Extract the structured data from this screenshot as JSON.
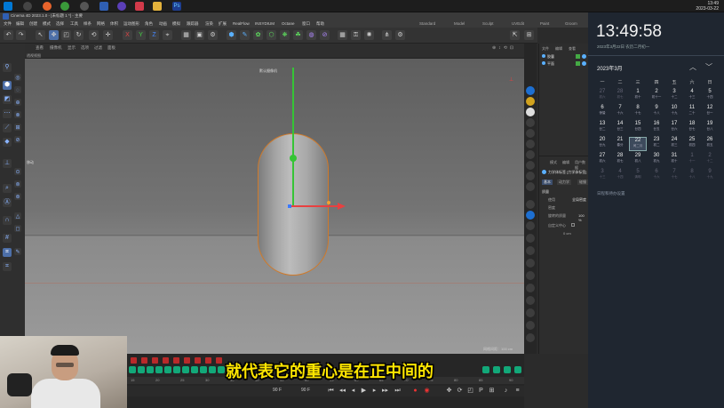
{
  "taskbar": {
    "time": "13:49",
    "date": "2023-03-22"
  },
  "window": {
    "title": "Cinema 4D 2023.1.0 - [未标题 1 *] - 主要",
    "tab_label": "未标题 1 *"
  },
  "menu": {
    "items": [
      "文件",
      "编辑",
      "创建",
      "模式",
      "选择",
      "工具",
      "样条",
      "网格",
      "体积",
      "运动图形",
      "角色",
      "动画",
      "模拟",
      "跟踪器",
      "渲染",
      "扩展",
      "RealFlow",
      "INSYDIUM",
      "Octane",
      "窗口",
      "帮助"
    ],
    "layouts": [
      "Standard",
      "Model",
      "Sculpt",
      "UVEdit",
      "Paint",
      "Groom"
    ]
  },
  "viewport": {
    "menu": [
      "查看",
      "摄像机",
      "显示",
      "选项",
      "过滤",
      "面板"
    ],
    "label": "透视视图",
    "camera": "默认摄像机",
    "move_label": "移动",
    "grid_spacing": "网格间距：100 cm"
  },
  "object_manager": {
    "tabs": [
      "文件",
      "编辑",
      "查看"
    ],
    "objects": [
      "胶囊",
      "平面"
    ]
  },
  "attribute_manager": {
    "tabs": [
      "模式",
      "编辑",
      "用户数据"
    ],
    "object_label": "力学体标签 [力学体标签]",
    "subtabs": [
      "基本",
      "动力学",
      "碰撞"
    ],
    "section": "质量",
    "rows": [
      {
        "label": "使用",
        "value": "全局密度"
      },
      {
        "label": "密度",
        "value": ""
      },
      {
        "label": "旋转的质量",
        "value": "100 %"
      },
      {
        "label": "自定义中心",
        "value": ""
      }
    ],
    "center_values": [
      "0 cm",
      "0 cm",
      "0 cm"
    ]
  },
  "timeline": {
    "ruler": [
      "15",
      "20",
      "25",
      "30",
      "35",
      "40",
      "45",
      "50",
      "55",
      "60",
      "65",
      "70",
      "75",
      "80",
      "85",
      "90"
    ],
    "frame_start": "90 F",
    "frame_end": "90 F"
  },
  "calendar": {
    "time": "13:49:58",
    "date_line": "2023年3月22日 农历二月初一",
    "month": "2023年3月",
    "weekdays": [
      "一",
      "二",
      "三",
      "四",
      "五",
      "六",
      "日"
    ],
    "days": [
      {
        "n": "27",
        "l": "初六",
        "dim": true
      },
      {
        "n": "28",
        "l": "初七",
        "dim": true
      },
      {
        "n": "1",
        "l": "初十"
      },
      {
        "n": "2",
        "l": "初十一"
      },
      {
        "n": "3",
        "l": "十二"
      },
      {
        "n": "4",
        "l": "十三"
      },
      {
        "n": "5",
        "l": "十四"
      },
      {
        "n": "6",
        "l": "惊蛰"
      },
      {
        "n": "7",
        "l": "十六"
      },
      {
        "n": "8",
        "l": "十七"
      },
      {
        "n": "9",
        "l": "十八"
      },
      {
        "n": "10",
        "l": "十九"
      },
      {
        "n": "11",
        "l": "二十"
      },
      {
        "n": "12",
        "l": "廿一"
      },
      {
        "n": "13",
        "l": "廿二"
      },
      {
        "n": "14",
        "l": "廿三"
      },
      {
        "n": "15",
        "l": "廿四"
      },
      {
        "n": "16",
        "l": "廿五"
      },
      {
        "n": "17",
        "l": "廿六"
      },
      {
        "n": "18",
        "l": "廿七"
      },
      {
        "n": "19",
        "l": "廿八"
      },
      {
        "n": "20",
        "l": "廿九"
      },
      {
        "n": "21",
        "l": "春分"
      },
      {
        "n": "22",
        "l": "闰二月",
        "today": true
      },
      {
        "n": "23",
        "l": "初二"
      },
      {
        "n": "24",
        "l": "初三"
      },
      {
        "n": "25",
        "l": "初四"
      },
      {
        "n": "26",
        "l": "初五"
      },
      {
        "n": "27",
        "l": "初六"
      },
      {
        "n": "28",
        "l": "初七"
      },
      {
        "n": "29",
        "l": "初八"
      },
      {
        "n": "30",
        "l": "初九"
      },
      {
        "n": "31",
        "l": "初十"
      },
      {
        "n": "1",
        "l": "十一",
        "dim": true
      },
      {
        "n": "2",
        "l": "十二",
        "dim": true
      },
      {
        "n": "3",
        "l": "十三",
        "dim": true
      },
      {
        "n": "4",
        "l": "十四",
        "dim": true
      },
      {
        "n": "5",
        "l": "清明",
        "dim": true
      },
      {
        "n": "6",
        "l": "十六",
        "dim": true
      },
      {
        "n": "7",
        "l": "十七",
        "dim": true
      },
      {
        "n": "8",
        "l": "十八",
        "dim": true
      },
      {
        "n": "9",
        "l": "十九",
        "dim": true
      }
    ],
    "footer": "日程和待办设置"
  },
  "subtitle": "就代表它的重心是在正中间的",
  "colors": {
    "accent": "#ffe600",
    "keyframe": "#b82a2a",
    "capsule_outline": "#d07a2a"
  }
}
